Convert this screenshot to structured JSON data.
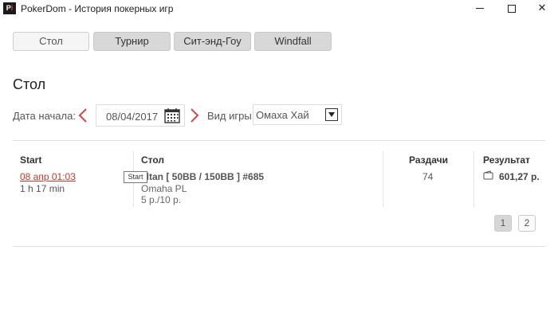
{
  "window": {
    "icon_text": "P",
    "icon_text_accent": "I",
    "title": "PokerDom - История покерных игр"
  },
  "tabs": [
    {
      "label": "Стол",
      "active": true
    },
    {
      "label": "Турнир",
      "active": false
    },
    {
      "label": "Сит-энд-Гоу",
      "active": false
    },
    {
      "label": "Windfall",
      "active": false
    }
  ],
  "section_title": "Стол",
  "filters": {
    "date_label": "Дата начала:",
    "date_value": "08/04/2017",
    "game_type_label": "Вид игры:",
    "game_type_value": "Омаха Хай"
  },
  "table": {
    "headers": {
      "start": "Start",
      "table": "Стол",
      "hands": "Раздачи",
      "result": "Результат"
    },
    "rows": [
      {
        "start_date": "08 апр 01:03",
        "duration": "1 h 17 min",
        "table_name": "altan [ 50BB / 150BB ] #685",
        "game": "Omaha PL",
        "stakes": "5 р./10 р.",
        "hands": "74",
        "result": "601,27 р."
      }
    ]
  },
  "tooltip": "Start",
  "pagination": {
    "pages": [
      "1",
      "2"
    ],
    "current": "1"
  },
  "colors": {
    "accent_red": "#c0392b",
    "tab_inactive": "#d8d8d8",
    "tab_active": "#f5f5f5"
  }
}
